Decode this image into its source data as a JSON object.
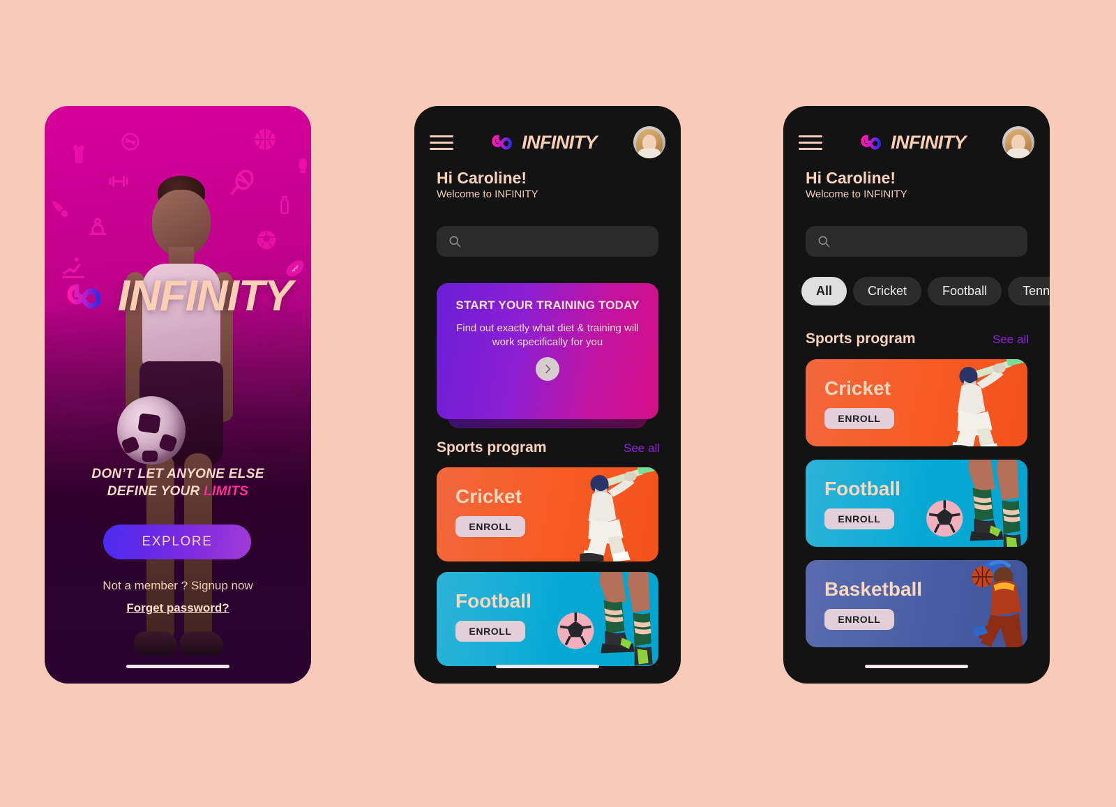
{
  "canvas": {
    "background_color": "#f9cab7"
  },
  "brand": {
    "name": "INFINITY",
    "glyph": "infinity-symbol",
    "gradient_from": "#ff1aa8",
    "gradient_to": "#2b2bea"
  },
  "screen1": {
    "hero_title": "INFINITY",
    "tagline_line1": "DON’T LET ANYONE ELSE",
    "tagline_line2_prefix": "DEFINE YOUR ",
    "tagline_highlight": "LIMITS",
    "explore_label": "EXPLORE",
    "signup_text": "Not a member ? Signup now",
    "forget_password": "Forget password?",
    "accent_pink": "#ff2f9a",
    "button_gradient_from": "#4b2bf0",
    "button_gradient_to": "#a23ad6",
    "background_icons": [
      "tank-top-icon",
      "no-smoking-icon",
      "basketball-icon",
      "dumbbell-icon",
      "shuttlecock-icon",
      "tennis-racket-icon",
      "yoga-pose-icon",
      "water-bottle-icon",
      "soccer-ball-icon",
      "american-football-icon",
      "rowing-icon",
      "boxing-glove-icon"
    ]
  },
  "screen2": {
    "menu_icon": "hamburger-icon",
    "avatar_icon": "user-avatar",
    "greeting": "Hi Caroline!",
    "welcome": "Welcome to INFINITY",
    "search": {
      "value": "",
      "placeholder": "",
      "icon": "search-icon"
    },
    "training_card": {
      "title": "START YOUR TRAINING TODAY",
      "subtitle": "Find out exactly what diet & training will work specifically for you",
      "next_icon": "chevron-right-icon",
      "gradient_from": "#6a1fd6",
      "gradient_to": "#d40f86"
    },
    "section": {
      "title": "Sports program",
      "see_all": "See all",
      "see_all_color": "#8f22dd"
    },
    "cards": [
      {
        "name": "Cricket",
        "enroll_label": "ENROLL",
        "color": "#f75a22",
        "art": "cricket-batsman-photo"
      },
      {
        "name": "Football",
        "enroll_label": "ENROLL",
        "color": "#06a9d4",
        "art": "footballer-legs-photo"
      }
    ]
  },
  "screen3": {
    "menu_icon": "hamburger-icon",
    "avatar_icon": "user-avatar",
    "greeting": "Hi Caroline!",
    "welcome": "Welcome to INFINITY",
    "search": {
      "value": "",
      "placeholder": "",
      "icon": "search-icon"
    },
    "filters": [
      {
        "label": "All",
        "active": true
      },
      {
        "label": "Cricket",
        "active": false
      },
      {
        "label": "Football",
        "active": false
      },
      {
        "label": "Tennis",
        "active": false
      }
    ],
    "section": {
      "title": "Sports program",
      "see_all": "See all",
      "see_all_color": "#8f22dd"
    },
    "cards": [
      {
        "name": "Cricket",
        "enroll_label": "ENROLL",
        "color": "#f75a22",
        "art": "cricket-batsman-photo"
      },
      {
        "name": "Football",
        "enroll_label": "ENROLL",
        "color": "#06a9d4",
        "art": "footballer-legs-photo"
      },
      {
        "name": "Basketball",
        "enroll_label": "ENROLL",
        "color": "#475da3",
        "art": "basketball-dunk-photo"
      }
    ]
  }
}
